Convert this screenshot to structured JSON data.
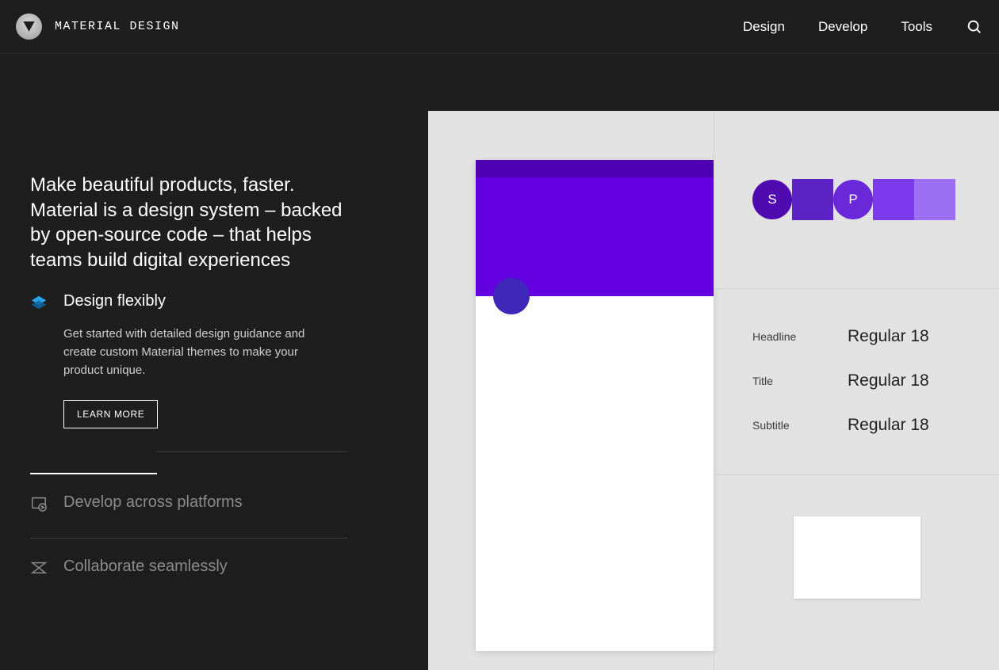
{
  "header": {
    "brand": "MATERIAL DESIGN",
    "nav": [
      "Design",
      "Develop",
      "Tools"
    ]
  },
  "hero": "Make beautiful products, faster. Material is a design system – backed by open-source code – that helps teams build digital experiences",
  "items": [
    {
      "title": "Design flexibly",
      "desc": "Get started with detailed design guidance and create custom Material themes to make your product unique.",
      "cta": "LEARN MORE",
      "active": true
    },
    {
      "title": "Develop across platforms",
      "active": false
    },
    {
      "title": "Collaborate seamlessly",
      "active": false
    }
  ],
  "palette": {
    "labels": [
      "S",
      "P"
    ],
    "colors": {
      "primary_dark": "#4f00b3",
      "primary": "#6300e0",
      "fab": "#3f28b9"
    }
  },
  "typography": [
    {
      "label": "Headline",
      "sample": "Regular 18"
    },
    {
      "label": "Title",
      "sample": "Regular 18"
    },
    {
      "label": "Subtitle",
      "sample": "Regular 18"
    }
  ]
}
